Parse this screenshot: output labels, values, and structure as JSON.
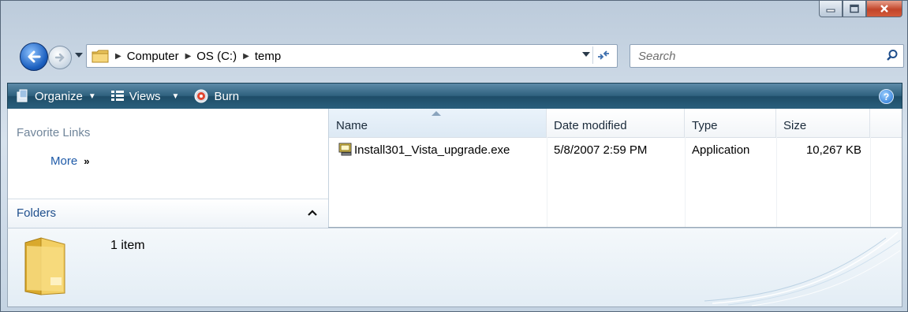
{
  "window": {
    "caption_buttons": [
      "minimize",
      "maximize",
      "close"
    ]
  },
  "navigation": {
    "breadcrumbs": [
      "Computer",
      "OS (C:)",
      "temp"
    ],
    "search_placeholder": "Search"
  },
  "toolbar": {
    "items": [
      {
        "label": "Organize",
        "icon": "organize-icon",
        "has_dropdown": true
      },
      {
        "label": "Views",
        "icon": "views-icon",
        "has_dropdown": true
      },
      {
        "label": "Burn",
        "icon": "burn-disc-icon",
        "has_dropdown": false
      }
    ],
    "help_glyph": "?"
  },
  "nav_pane": {
    "favorite_links_label": "Favorite Links",
    "more_label": "More",
    "more_chevron": "»",
    "folders_label": "Folders"
  },
  "file_list": {
    "columns": [
      "Name",
      "Date modified",
      "Type",
      "Size"
    ],
    "sorted_by": "Name",
    "rows": [
      {
        "name": "Install301_Vista_upgrade.exe",
        "date_modified": "5/8/2007 2:59 PM",
        "type": "Application",
        "size": "10,267 KB",
        "icon": "application-exe-icon"
      }
    ]
  },
  "details_pane": {
    "item_count": "1 item",
    "icon": "folder-icon"
  },
  "colors": {
    "toolbar_accent": "#2f627f",
    "link_blue": "#1e5aa8",
    "close_red": "#c2452a"
  }
}
